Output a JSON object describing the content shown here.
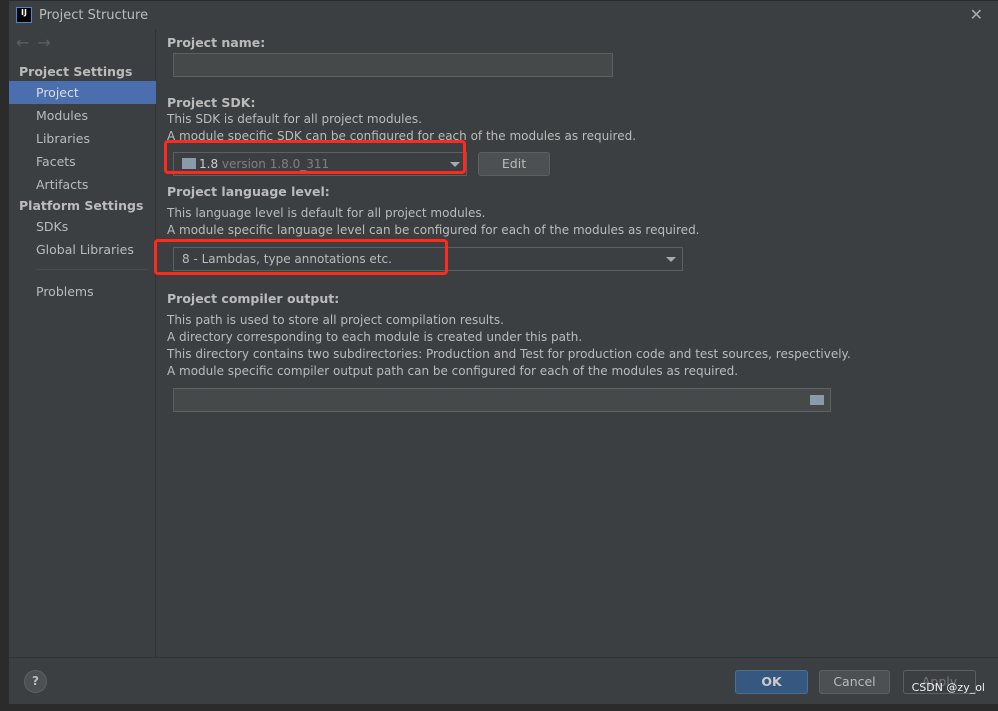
{
  "window": {
    "title": "Project Structure",
    "logo": "IJ"
  },
  "sidebar": {
    "section1": "Project Settings",
    "items1": [
      "Project",
      "Modules",
      "Libraries",
      "Facets",
      "Artifacts"
    ],
    "section2": "Platform Settings",
    "items2": [
      "SDKs",
      "Global Libraries"
    ],
    "problems": "Problems",
    "selected": "Project"
  },
  "main": {
    "name_label": "Project name:",
    "name_value": "",
    "sdk_label": "Project SDK:",
    "sdk_desc1": "This SDK is default for all project modules.",
    "sdk_desc2": "A module specific SDK can be configured for each of the modules as required.",
    "sdk_name": "1.8",
    "sdk_version": "version 1.8.0_311",
    "edit": "Edit",
    "lang_label": "Project language level:",
    "lang_desc1": "This language level is default for all project modules.",
    "lang_desc2": "A module specific language level can be configured for each of the modules as required.",
    "lang_value": "8 - Lambdas, type annotations etc.",
    "out_label": "Project compiler output:",
    "out_desc": [
      "This path is used to store all project compilation results.",
      "A directory corresponding to each module is created under this path.",
      "This directory contains two subdirectories: Production and Test for production code and test sources, respectively.",
      "A module specific compiler output path can be configured for each of the modules as required."
    ],
    "out_value": ""
  },
  "footer": {
    "help": "?",
    "ok": "OK",
    "cancel": "Cancel",
    "apply": "Apply"
  },
  "watermark": "CSDN @zy_ol",
  "colors": {
    "selection": "#4b6eaf",
    "highlight": "#ff2a1f",
    "ok": "#365880"
  }
}
